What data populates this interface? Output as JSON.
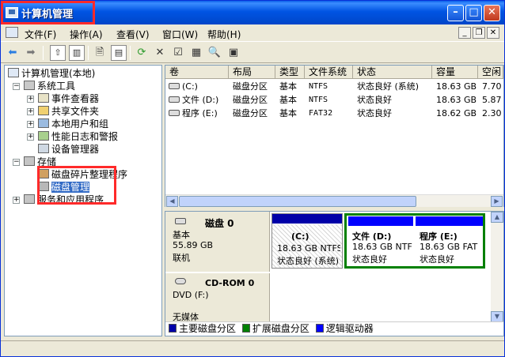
{
  "window": {
    "title": "计算机管理"
  },
  "menu": [
    "文件(F)",
    "操作(A)",
    "查看(V)",
    "窗口(W)",
    "帮助(H)"
  ],
  "tree": {
    "root": "计算机管理(本地)",
    "system_tools": "系统工具",
    "event_viewer": "事件查看器",
    "shared_folders": "共享文件夹",
    "local_users": "本地用户和组",
    "perf_logs": "性能日志和警报",
    "device_manager": "设备管理器",
    "storage": "存储",
    "defrag": "磁盘碎片整理程序",
    "disk_mgmt": "磁盘管理",
    "services": "服务和应用程序"
  },
  "volumes": {
    "columns": [
      "卷",
      "布局",
      "类型",
      "文件系统",
      "状态",
      "容量",
      "空闲"
    ],
    "rows": [
      [
        "(C:)",
        "磁盘分区",
        "基本",
        "NTFS",
        "状态良好 (系统)",
        "18.63 GB",
        "7.70"
      ],
      [
        "文件 (D:)",
        "磁盘分区",
        "基本",
        "NTFS",
        "状态良好",
        "18.63 GB",
        "5.87"
      ],
      [
        "程序 (E:)",
        "磁盘分区",
        "基本",
        "FAT32",
        "状态良好",
        "18.62 GB",
        "2.30"
      ]
    ]
  },
  "disks": {
    "disk0": {
      "name": "磁盘 0",
      "type": "基本",
      "size": "55.89 GB",
      "status": "联机"
    },
    "parts": [
      {
        "name": "(C:)",
        "size": "18.63 GB NTFS",
        "status": "状态良好 (系统)"
      },
      {
        "name": "文件 (D:)",
        "size": "18.63 GB NTF",
        "status": "状态良好"
      },
      {
        "name": "程序 (E:)",
        "size": "18.63 GB FAT",
        "status": "状态良好"
      }
    ],
    "cdrom": {
      "name": "CD-ROM 0",
      "type": "DVD (F:)",
      "status": "无媒体"
    }
  },
  "legend": [
    "主要磁盘分区",
    "扩展磁盘分区",
    "逻辑驱动器"
  ],
  "colors": {
    "primary": "#0000a8",
    "extended": "#008000",
    "logical": "#0000ff"
  }
}
